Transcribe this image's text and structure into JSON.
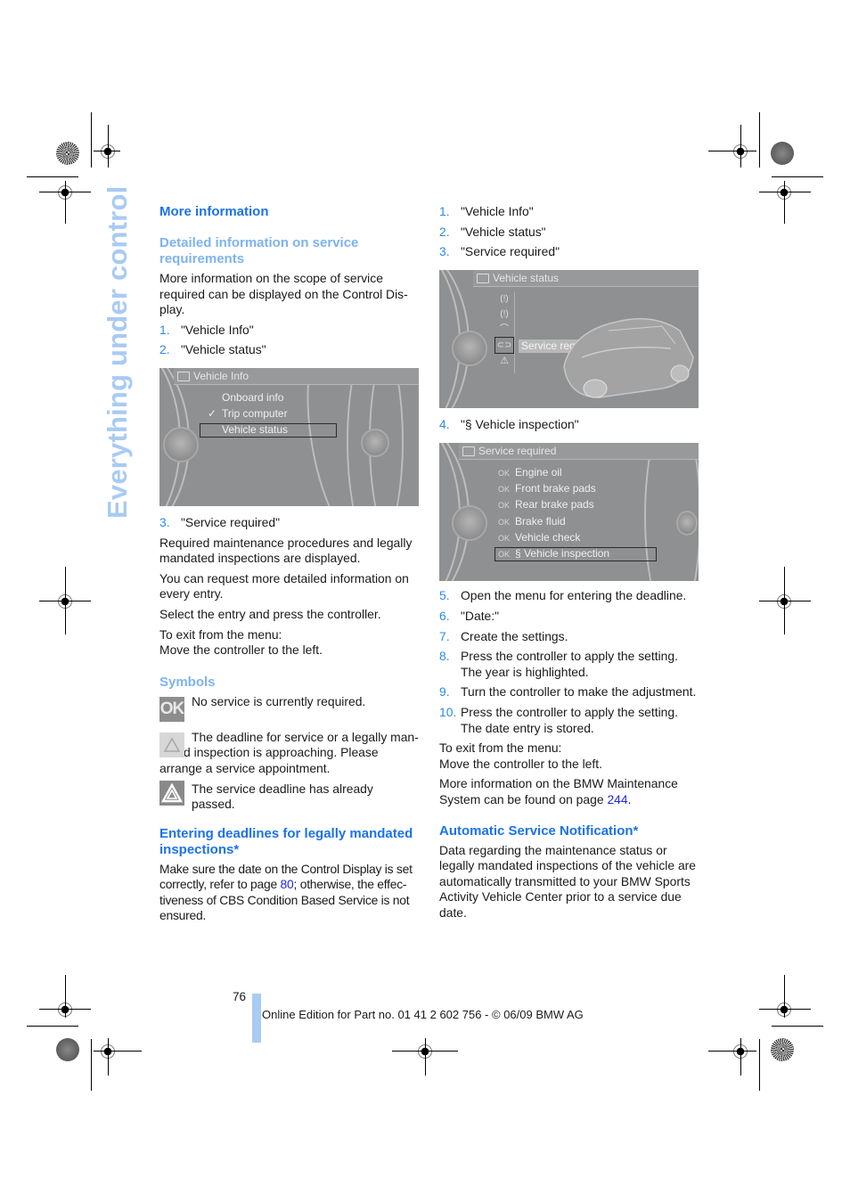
{
  "side_tab": {
    "title": "Everything under control"
  },
  "left": {
    "section_title": "More information",
    "subsection_title": "Detailed information on service requirements",
    "intro": "More information on the scope of service required can be displayed on the Control Dis-play.",
    "steps_a": [
      {
        "num": "1.",
        "text": "\"Vehicle Info\""
      },
      {
        "num": "2.",
        "text": "\"Vehicle status\""
      }
    ],
    "screen_vehicle_info": {
      "header": "Vehicle Info",
      "items": [
        "Onboard info",
        "Trip computer",
        "Vehicle status"
      ],
      "checked_item": "Trip computer",
      "selected_item": "Vehicle status"
    },
    "steps_b": [
      {
        "num": "3.",
        "text": "\"Service required\""
      }
    ],
    "paragraphs": [
      "Required maintenance procedures and legally mandated inspections are displayed.",
      "You can request more detailed information on every entry.",
      "Select the entry and press the controller."
    ],
    "exit_line1": "To exit from the menu:",
    "exit_line2": "Move the controller to the left.",
    "symbols_title": "Symbols",
    "symbols": [
      {
        "icon": "ok-icon",
        "label": "OK",
        "text": "No service is currently required."
      },
      {
        "icon": "warning-light-icon",
        "text": "The deadline for service or a legally man-dated inspection is approaching. Please arrange a service appointment."
      },
      {
        "icon": "warning-dark-icon",
        "text": "The service deadline has already passed."
      }
    ],
    "deadlines_title": "Entering deadlines for legally mandated inspections*",
    "deadlines_text_before": "Make sure the date on the Control Display is set correctly, refer to page ",
    "deadlines_link": "80",
    "deadlines_text_after": "; otherwise, the effec-tiveness of CBS Condition Based Service is not ensured."
  },
  "right": {
    "steps_a": [
      {
        "num": "1.",
        "text": "\"Vehicle Info\""
      },
      {
        "num": "2.",
        "text": "\"Vehicle status\""
      },
      {
        "num": "3.",
        "text": "\"Service required\""
      }
    ],
    "screen_vehicle_status": {
      "header": "Vehicle status",
      "selected_item": "Service required"
    },
    "steps_b": [
      {
        "num": "4.",
        "text": "\"§ Vehicle inspection\""
      }
    ],
    "screen_service_required": {
      "header": "Service required",
      "items": [
        {
          "status": "OK",
          "label": "Engine oil"
        },
        {
          "status": "OK",
          "label": "Front brake pads"
        },
        {
          "status": "OK",
          "label": "Rear brake pads"
        },
        {
          "status": "OK",
          "label": "Brake fluid"
        },
        {
          "status": "OK",
          "label": "Vehicle check"
        },
        {
          "status": "OK",
          "label": "§ Vehicle inspection"
        }
      ],
      "selected_item": "§ Vehicle inspection"
    },
    "steps_c": [
      {
        "num": "5.",
        "text": "Open the menu for entering the deadline."
      },
      {
        "num": "6.",
        "text": "\"Date:\""
      },
      {
        "num": "7.",
        "text": "Create the settings."
      },
      {
        "num": "8.",
        "text": "Press the controller to apply the setting.",
        "text2": "The year is highlighted."
      },
      {
        "num": "9.",
        "text": "Turn the controller to make the adjustment."
      },
      {
        "num": "10.",
        "text": "Press the controller to apply the setting.",
        "text2": "The date entry is stored."
      }
    ],
    "exit_line1": "To exit from the menu:",
    "exit_line2": "Move the controller to the left.",
    "more_info_before": "More information on the BMW Maintenance System can be found on page ",
    "more_info_link": "244",
    "more_info_after": ".",
    "auto_title": "Automatic Service Notification*",
    "auto_text": "Data regarding the maintenance status or legally mandated inspections of the vehicle are automatically transmitted to your BMW Sports Activity Vehicle Center prior to a service due date."
  },
  "footer": {
    "page_number": "76",
    "edition": "Online Edition for Part no. 01 41 2 602 756 - © 06/09 BMW AG"
  },
  "colors": {
    "heading_blue": "#1a73e8",
    "subheading_blue": "#7db3f0",
    "side_tab_blue": "#a8cbf3",
    "link_blue": "#1a2bd8",
    "step_number_blue": "#2a8be8"
  }
}
